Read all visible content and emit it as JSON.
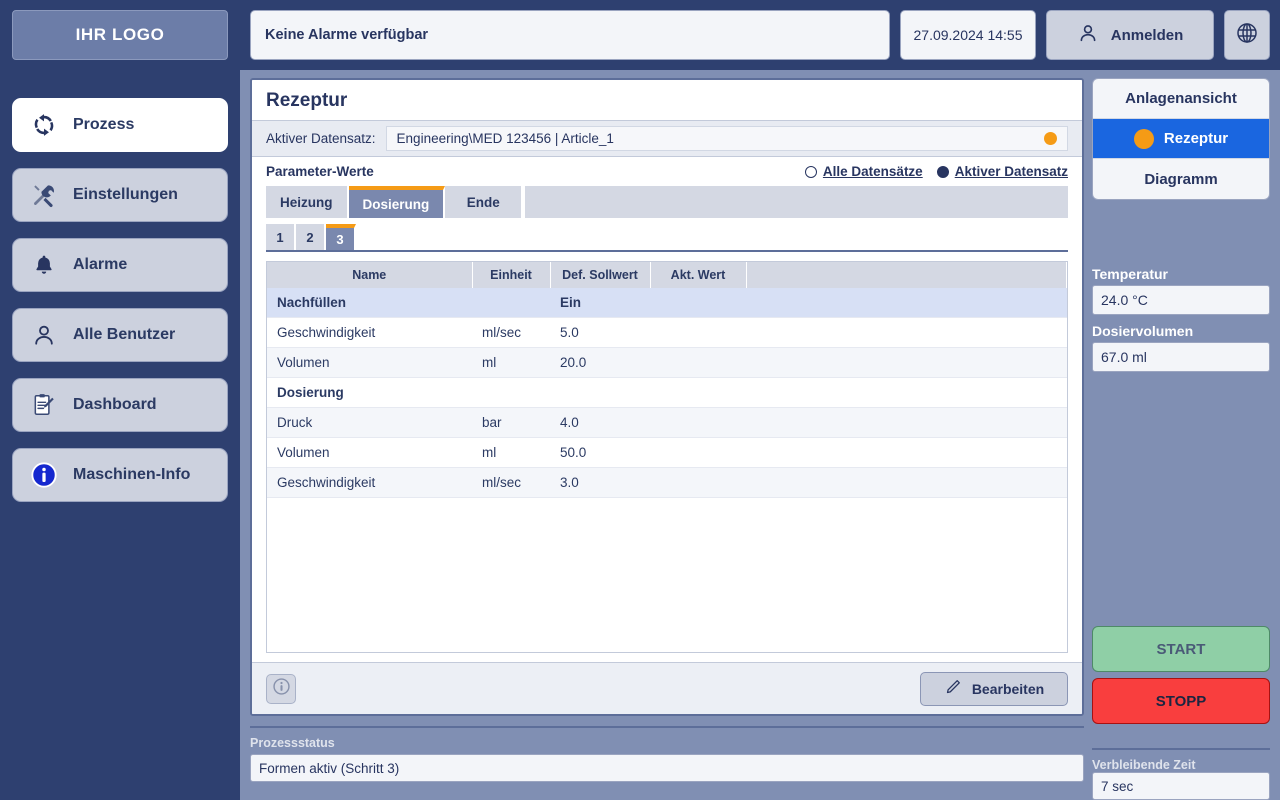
{
  "colors": {
    "sidebar_bg": "#2e4070",
    "page_bg": "#808fb3",
    "accent_orange": "#f59b16",
    "accent_blue": "#1a66e0",
    "text_navy": "#283560",
    "start_green": "#8fcfa6",
    "stop_red": "#f93e3e"
  },
  "sidebar": {
    "logo": "IHR LOGO",
    "items": [
      {
        "label": "Prozess",
        "icon": "refresh-cycle-icon",
        "active": true
      },
      {
        "label": "Einstellungen",
        "icon": "tools-icon",
        "active": false
      },
      {
        "label": "Alarme",
        "icon": "bell-icon",
        "active": false
      },
      {
        "label": "Alle Benutzer",
        "icon": "user-icon",
        "active": false
      },
      {
        "label": "Dashboard",
        "icon": "clipboard-pencil-icon",
        "active": false
      },
      {
        "label": "Maschinen-Info",
        "icon": "info-circle-icon",
        "active": false
      }
    ]
  },
  "topbar": {
    "alarm_text": "Keine Alarme verfügbar",
    "datetime": "27.09.2024 14:55",
    "login_label": "Anmelden",
    "login_icon": "user-icon",
    "language_icon": "globe-icon"
  },
  "panel": {
    "title": "Rezeptur",
    "dataset_label": "Aktiver Datensatz:",
    "dataset_value": "Engineering\\MED 123456  |  Article_1",
    "dataset_status_icon": "status-dot-orange",
    "parameter_label": "Parameter-Werte",
    "radios": [
      {
        "label": "Alle Datensätze",
        "selected": false
      },
      {
        "label": "Aktiver Datensatz",
        "selected": true
      }
    ],
    "tabs": [
      {
        "label": "Heizung",
        "active": false
      },
      {
        "label": "Dosierung",
        "active": true
      },
      {
        "label": "Ende",
        "active": false
      }
    ],
    "subtabs": [
      {
        "label": "1",
        "active": false
      },
      {
        "label": "2",
        "active": false
      },
      {
        "label": "3",
        "active": true
      }
    ],
    "table": {
      "columns": [
        "Name",
        "Einheit",
        "Def. Sollwert",
        "Akt. Wert",
        ""
      ],
      "rows": [
        {
          "type": "group",
          "highlight": true,
          "name": "Nachfüllen",
          "unit": "",
          "setpoint": "Ein",
          "actual": ""
        },
        {
          "type": "data",
          "highlight": false,
          "name": "Geschwindigkeit",
          "unit": "ml/sec",
          "setpoint": "5.0",
          "actual": ""
        },
        {
          "type": "data",
          "highlight": false,
          "name": "Volumen",
          "unit": "ml",
          "setpoint": "20.0",
          "actual": ""
        },
        {
          "type": "group",
          "highlight": false,
          "name": "Dosierung",
          "unit": "",
          "setpoint": "",
          "actual": ""
        },
        {
          "type": "data",
          "highlight": false,
          "name": "Druck",
          "unit": "bar",
          "setpoint": "4.0",
          "actual": ""
        },
        {
          "type": "data",
          "highlight": false,
          "name": "Volumen",
          "unit": "ml",
          "setpoint": "50.0",
          "actual": ""
        },
        {
          "type": "data",
          "highlight": false,
          "name": "Geschwindigkeit",
          "unit": "ml/sec",
          "setpoint": "3.0",
          "actual": ""
        }
      ]
    },
    "footer": {
      "info_icon": "info-circle-icon",
      "edit_label": "Bearbeiten",
      "edit_icon": "pencil-icon"
    }
  },
  "rail": {
    "views": [
      {
        "label": "Anlagenansicht",
        "active": false,
        "dot": false
      },
      {
        "label": "Rezeptur",
        "active": true,
        "dot": true
      },
      {
        "label": "Diagramm",
        "active": false,
        "dot": false
      }
    ],
    "fields": [
      {
        "label": "Temperatur",
        "value": "24.0 °C"
      },
      {
        "label": "Dosiervolumen",
        "value": "67.0 ml"
      }
    ],
    "start_label": "START",
    "stop_label": "STOPP",
    "time_label": "Verbleibende Zeit",
    "time_value": "7 sec"
  },
  "statusbar": {
    "process_label": "Prozessstatus",
    "process_value": "Formen aktiv (Schritt 3)"
  }
}
